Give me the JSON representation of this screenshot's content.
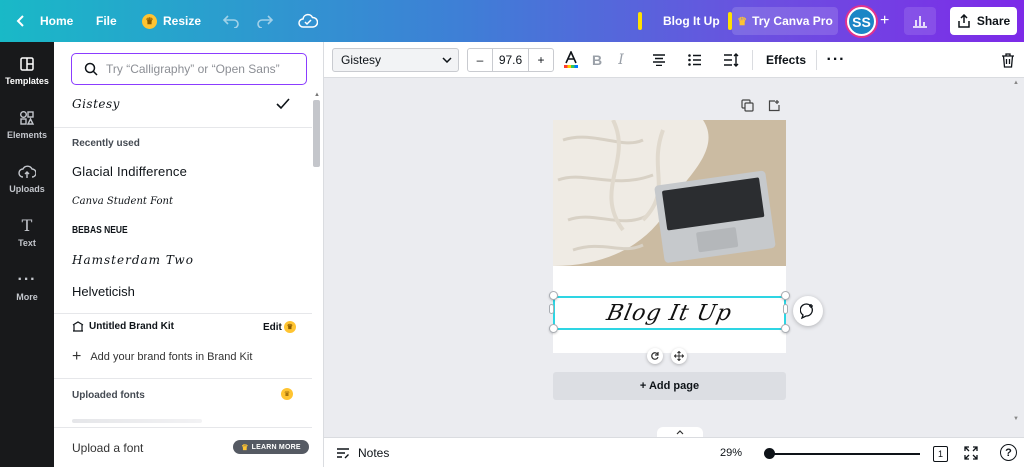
{
  "topbar": {
    "home": "Home",
    "file": "File",
    "resize": "Resize",
    "doc_title": "Blog It Up",
    "try_pro": "Try Canva Pro",
    "avatar_initials": "SS",
    "share": "Share"
  },
  "rail": {
    "templates": "Templates",
    "elements": "Elements",
    "uploads": "Uploads",
    "text": "Text",
    "more": "More"
  },
  "font_panel": {
    "search_placeholder": "Try “Calligraphy” or “Open Sans”",
    "current_font": "Gistesy",
    "recently_used_title": "Recently used",
    "recent_fonts": [
      "Glacial Indifference",
      "Canva Student Font",
      "BEBAS NEUE",
      "Hamsterdam Two",
      "Helveticish"
    ],
    "brand_kit_title": "Untitled Brand Kit",
    "brand_kit_edit": "Edit",
    "add_brand_fonts": "Add your brand fonts in Brand Kit",
    "uploaded_fonts_title": "Uploaded fonts",
    "upload_font": "Upload a font",
    "learn_more": "LEARN MORE"
  },
  "toolbar": {
    "font_family": "Gistesy",
    "font_size": "97.6",
    "effects": "Effects"
  },
  "canvas": {
    "text_element": "Blog It Up",
    "add_page": "+ Add page"
  },
  "bottombar": {
    "notes": "Notes",
    "zoom": "29%",
    "page_number": "1"
  },
  "colors": {
    "accent": "#8b3dff",
    "selection": "#2ed5e3",
    "crown": "#ffc431"
  }
}
